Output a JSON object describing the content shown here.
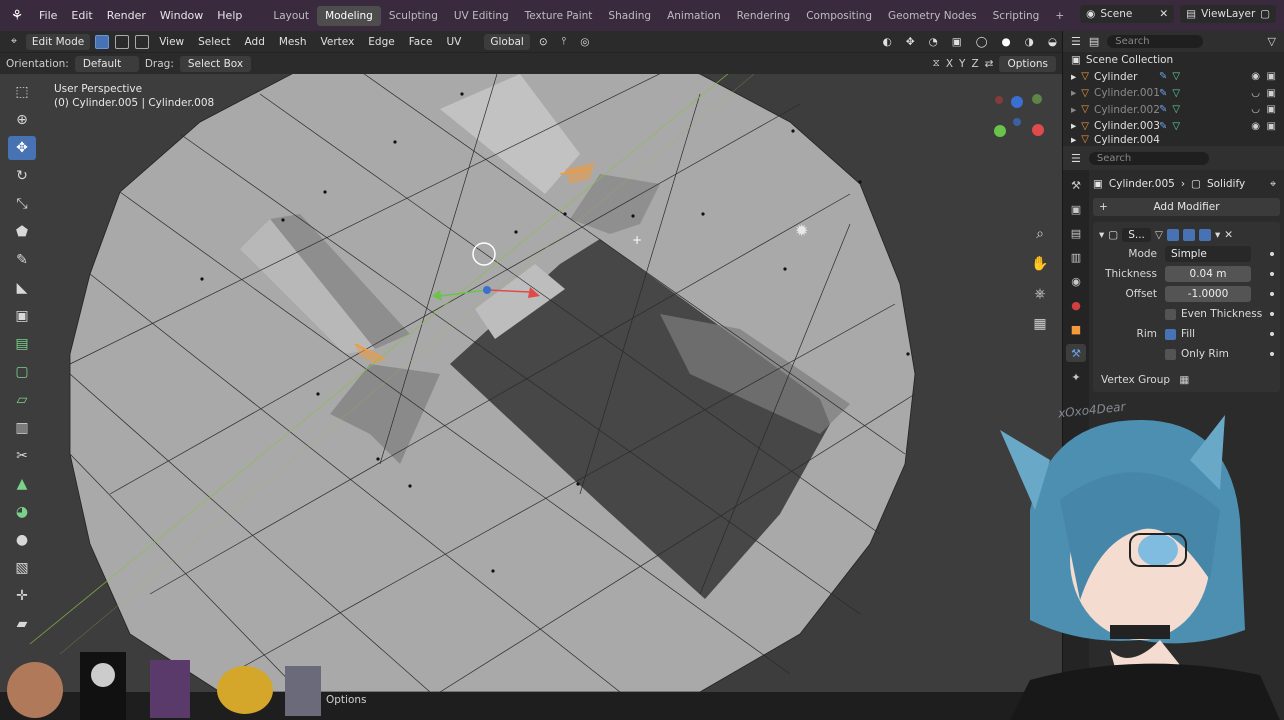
{
  "topbar": {
    "menus": [
      "File",
      "Edit",
      "Render",
      "Window",
      "Help"
    ],
    "workspaces": [
      "Layout",
      "Modeling",
      "Sculpting",
      "UV Editing",
      "Texture Paint",
      "Shading",
      "Animation",
      "Rendering",
      "Compositing",
      "Geometry Nodes",
      "Scripting"
    ],
    "active_workspace": "Modeling",
    "scene": "Scene",
    "view_layer": "ViewLayer"
  },
  "viewport_header": {
    "mode": "Edit Mode",
    "menus": [
      "View",
      "Select",
      "Add",
      "Mesh",
      "Vertex",
      "Edge",
      "Face",
      "UV"
    ],
    "transform_orientation": "Global"
  },
  "tool_settings": {
    "orientation_label": "Orientation:",
    "orientation_value": "Default",
    "drag_label": "Drag:",
    "drag_value": "Select Box",
    "options_label": "Options",
    "axes": [
      "X",
      "Y",
      "Z"
    ]
  },
  "viewport": {
    "perspective": "User Perspective",
    "object_info": "(0) Cylinder.005 | Cylinder.008"
  },
  "status": {
    "options": "Options"
  },
  "outliner": {
    "search_placeholder": "Search",
    "collection": "Scene Collection",
    "items": [
      {
        "name": "Cylinder",
        "visible": true
      },
      {
        "name": "Cylinder.001",
        "visible": false
      },
      {
        "name": "Cylinder.002",
        "visible": false
      },
      {
        "name": "Cylinder.003",
        "visible": true
      },
      {
        "name": "Cylinder.004",
        "visible": true
      }
    ]
  },
  "properties": {
    "search_placeholder": "Search",
    "object": "Cylinder.005",
    "modifier_tab": "Solidify",
    "add_modifier": "Add Modifier",
    "modifier_short_name": "S...",
    "mode_label": "Mode",
    "mode_value": "Simple",
    "thickness_label": "Thickness",
    "thickness_value": "0.04 m",
    "offset_label": "Offset",
    "offset_value": "-1.0000",
    "even_thickness": "Even Thickness",
    "rim_label": "Rim",
    "fill_label": "Fill",
    "only_rim": "Only Rim",
    "vertex_group": "Vertex Group"
  },
  "overlay": {
    "watermark": "xOxo4Dear"
  },
  "colors": {
    "accent": "#4772b3",
    "selection_orange": "#f29a3c",
    "topbar": "#3a2a3e"
  }
}
